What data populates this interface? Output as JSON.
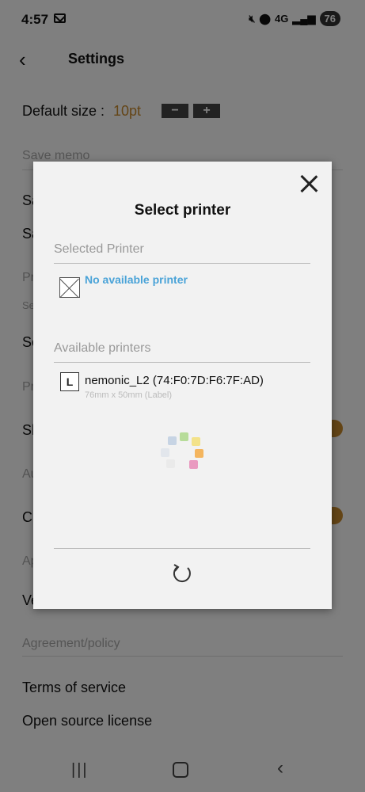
{
  "status_bar": {
    "time": "4:57",
    "network": "4G",
    "battery": "76"
  },
  "header": {
    "title": "Settings"
  },
  "background": {
    "default_size_label": "Default size :",
    "default_size_value": "10pt",
    "minus_label": "−",
    "plus_label": "+",
    "save_memo_section": "Save memo",
    "agreement_section": "Agreement/policy",
    "terms_of_service": "Terms of service",
    "open_source_license": "Open source license",
    "partial_rows": [
      "Sa",
      "Sa",
      "Pr",
      "Se",
      "Se",
      "Pr",
      "Sh",
      "Au",
      "Cu",
      "Ap",
      "Ve"
    ]
  },
  "dialog": {
    "title": "Select printer",
    "selected_section": "Selected Printer",
    "no_printer_text": "No available printer",
    "available_section": "Available printers",
    "printers": [
      {
        "type_letter": "L",
        "name": "nemonic_L2 (74:F0:7D:F6:7F:AD)",
        "spec": "76mm x 50mm (Label)"
      }
    ]
  },
  "colors": {
    "accent": "#c98a2c",
    "link": "#4aa3d8"
  },
  "icons": [
    "mail-icon",
    "mute-icon",
    "location-icon",
    "signal-icon",
    "back-arrow-icon",
    "close-icon",
    "no-printer-icon",
    "label-type-icon",
    "loading-spinner-icon",
    "refresh-icon",
    "nav-recents-icon",
    "nav-home-icon",
    "nav-back-icon"
  ]
}
